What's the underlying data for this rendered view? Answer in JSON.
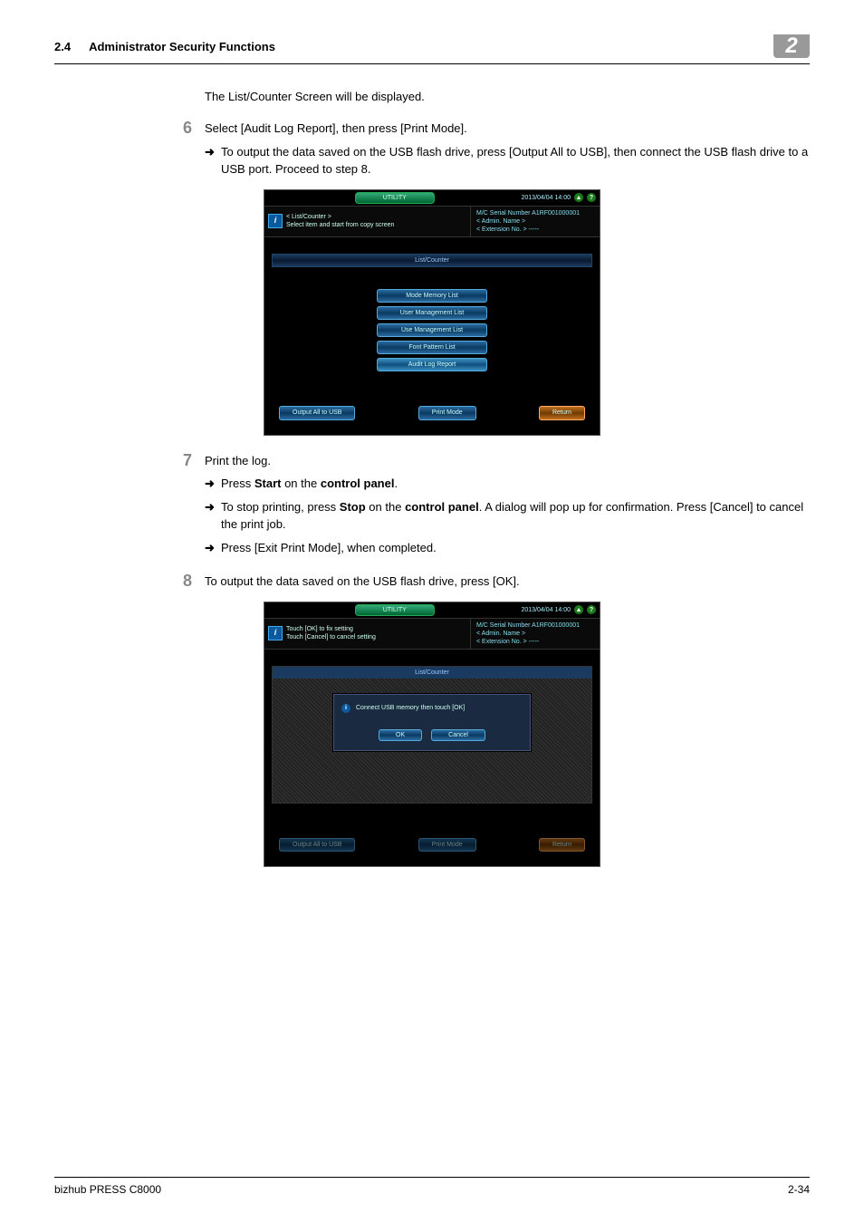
{
  "header": {
    "section_num": "2.4",
    "section_title": "Administrator Security Functions",
    "chapter": "2"
  },
  "intro": "The List/Counter Screen will be displayed.",
  "step6": {
    "num": "6",
    "text": "Select [Audit Log Report], then press [Print Mode].",
    "sub1": "To output the data saved on the USB flash drive, press [Output All to USB], then connect the USB flash drive to a USB port. Proceed to step 8."
  },
  "step7": {
    "num": "7",
    "text": "Print the log.",
    "sub1_pre": "Press ",
    "sub1_b1": "Start",
    "sub1_mid": " on the ",
    "sub1_b2": "control panel",
    "sub1_post": ".",
    "sub2_pre": "To stop printing, press ",
    "sub2_b1": "Stop",
    "sub2_mid": " on the ",
    "sub2_b2": "control panel",
    "sub2_post": ". A dialog will pop up for confirmation. Press [Cancel] to cancel the print job.",
    "sub3": "Press [Exit Print Mode], when completed."
  },
  "step8": {
    "num": "8",
    "text": "To output the data saved on the USB flash drive, press [OK]."
  },
  "panel_a": {
    "utility": "UTILITY",
    "datetime": "2013/04/04 14:00",
    "info_title": "< List/Counter >",
    "info_text": "Select item and start from copy screen",
    "serial_label": "M/C Serial Number",
    "serial_value": "A1RF001000001",
    "admin_label": "< Admin. Name >",
    "ext_label": "< Extension No. >",
    "ext_value": "-----",
    "section": "List/Counter",
    "buttons": [
      "Mode Memory List",
      "User Management List",
      "Use Management List",
      "Font Pattern List",
      "Audit Log Report"
    ],
    "foot_left": "Output All to USB",
    "foot_mid": "Print Mode",
    "foot_right": "Return"
  },
  "panel_b": {
    "utility": "UTILITY",
    "datetime": "2013/04/04 14:00",
    "info_line1": "Touch [OK] to fix setting",
    "info_line2": "Touch [Cancel] to cancel setting",
    "serial_label": "M/C Serial Number",
    "serial_value": "A1RF001000001",
    "admin_label": "< Admin. Name >",
    "ext_label": "< Extension No. >",
    "ext_value": "-----",
    "section": "List/Counter",
    "dialog_msg": "Connect USB memory then touch [OK]",
    "ok": "OK",
    "cancel": "Cancel",
    "foot_left": "Output All to USB",
    "foot_mid": "Print Mode",
    "foot_right": "Return"
  },
  "footer": {
    "product": "bizhub PRESS C8000",
    "page": "2-34"
  },
  "icons": {
    "i": "i",
    "help": "?",
    "up": "▲"
  }
}
